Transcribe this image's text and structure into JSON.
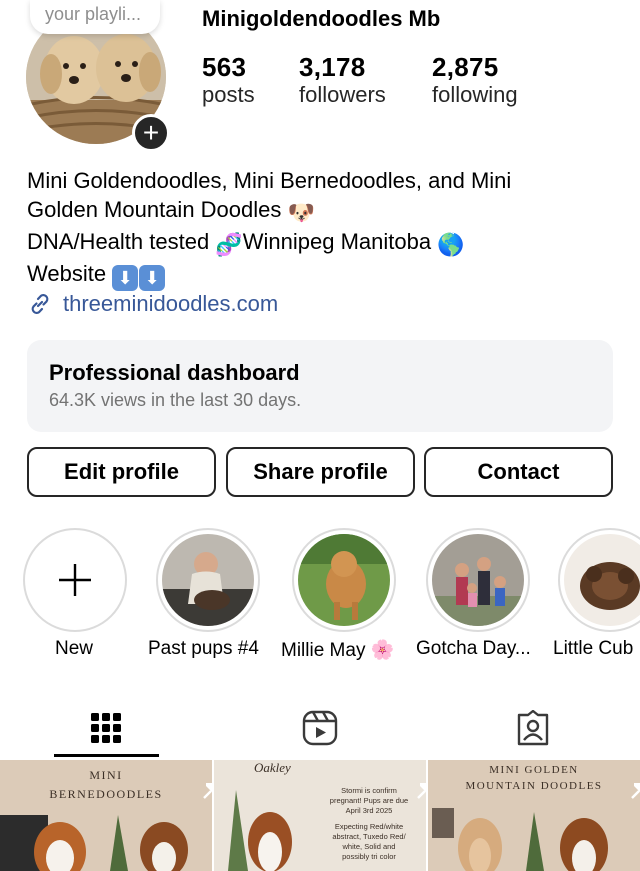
{
  "profile": {
    "note": "your playli...",
    "username": "Minigoldendoodles Mb",
    "stats": [
      {
        "value": "563",
        "label": "posts"
      },
      {
        "value": "3,178",
        "label": "followers"
      },
      {
        "value": "2,875",
        "label": "following"
      }
    ]
  },
  "bio": {
    "line1": "Mini Goldendoodles, Mini Bernedoodles, and Mini",
    "line2": "Golden Mountain Doodles",
    "line2_emoji": "🐶",
    "line3a": "DNA/Health tested",
    "line3_emoji_dna": "🧬",
    "line3b": "Winnipeg Manitoba",
    "line3_emoji_globe": "🌎",
    "line4": "Website",
    "line4_emoji": "⬇",
    "link": "threeminidoodles.com"
  },
  "dashboard": {
    "title": "Professional dashboard",
    "subtitle": "64.3K views in the last 30 days."
  },
  "buttons": {
    "edit": "Edit profile",
    "share": "Share profile",
    "contact": "Contact"
  },
  "highlights": [
    {
      "label": "New"
    },
    {
      "label": "Past pups #4"
    },
    {
      "label": "Millie May 🌸"
    },
    {
      "label": "Gotcha Day..."
    },
    {
      "label": "Little Cub"
    }
  ],
  "tabs": {
    "icons": [
      "grid-icon",
      "reels-icon",
      "tagged-icon"
    ],
    "active": "grid-icon"
  },
  "posts": [
    {
      "title_line1": "MINI",
      "title_line2": "BERNEDOODLES"
    },
    {
      "script_name": "Oakley",
      "text": [
        "Stormi is confirm",
        "pregnant! Pups are due",
        "April 3rd 2025",
        "",
        "Expecting Red/white",
        "abstract, Tuxedo Red/",
        "white, Solid and",
        "possibly tri color"
      ]
    },
    {
      "title_line1": "MINI GOLDEN",
      "title_line2": "MOUNTAIN DOODLES"
    }
  ],
  "colors": {
    "link": "#385898",
    "dashboard_bg": "#f3f4f6",
    "post_bg": "#d8c7b4"
  }
}
